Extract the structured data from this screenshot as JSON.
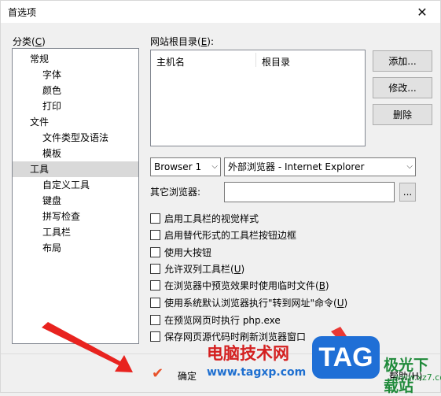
{
  "window": {
    "title": "首选项",
    "close_glyph": "✕"
  },
  "category": {
    "label": "分类(",
    "mnemonic": "C",
    "label_end": ")",
    "items": [
      "常规",
      "字体",
      "颜色",
      "打印",
      "文件",
      "文件类型及语法",
      "模板",
      "工具",
      "自定义工具",
      "键盘",
      "拼写检查",
      "工具栏",
      "布局"
    ],
    "selected": "工具"
  },
  "site_root": {
    "label": "网站根目录(",
    "mnemonic": "E",
    "label_end": "):",
    "columns": [
      "主机名",
      "根目录"
    ]
  },
  "buttons": {
    "add": "添加...",
    "edit": "修改...",
    "delete": "删除",
    "browse": "...",
    "ok": "确定",
    "help": "帮助(H)"
  },
  "browser": {
    "selected": "Browser 1",
    "external": "外部浏览器 - Internet Explorer",
    "other_label": "其它浏览器:",
    "other_value": ""
  },
  "options": [
    {
      "label": "启用工具栏的视觉样式",
      "checked": false
    },
    {
      "label": "启用替代形式的工具栏按钮边框",
      "checked": false
    },
    {
      "label": "使用大按钮",
      "checked": false
    },
    {
      "label": "允许双列工具栏(",
      "mn": "U",
      "end": ")",
      "checked": false
    },
    {
      "label": "在浏览器中预览效果时使用临时文件(",
      "mn": "B",
      "end": ")",
      "checked": false
    },
    {
      "label": "使用系统默认浏览器执行\"转到网址\"命令(",
      "mn": "U",
      "end": ")",
      "checked": false
    },
    {
      "label": "在预览网页时执行 php.exe",
      "checked": false
    },
    {
      "label": "保存网页源代码时刷新浏览器窗口",
      "checked": false
    }
  ],
  "watermark": {
    "site_name": "电脑技术网",
    "url": "www.tagxp.com",
    "badge": "TAG",
    "brand": "极光下载站",
    "brand_url": "www.xz7.com"
  }
}
